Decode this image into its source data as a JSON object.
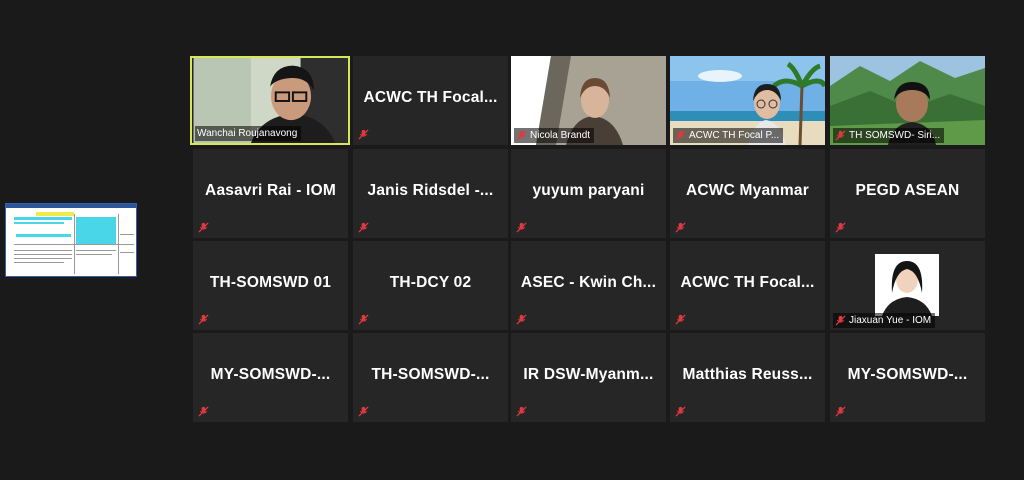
{
  "participants": [
    {
      "name": "Wanchai Roujanavong",
      "video": true,
      "active": true
    },
    {
      "name": "ACWC TH Focal...",
      "video": false
    },
    {
      "name": "Nicola Brandt",
      "video": true
    },
    {
      "name": "ACWC TH Focal P...",
      "video": true
    },
    {
      "name": "TH SOMSWD- Siri...",
      "video": true
    },
    {
      "name": "Aasavri Rai - IOM",
      "video": false
    },
    {
      "name": "Janis Ridsdel -...",
      "video": false
    },
    {
      "name": "yuyum paryani",
      "video": false
    },
    {
      "name": "ACWC Myanmar",
      "video": false
    },
    {
      "name": "PEGD ASEAN",
      "video": false
    },
    {
      "name": "TH-SOMSWD 01",
      "video": false
    },
    {
      "name": "TH-DCY 02",
      "video": false
    },
    {
      "name": "ASEC - Kwin Ch...",
      "video": false
    },
    {
      "name": "ACWC TH Focal...",
      "video": false
    },
    {
      "name": "Jiaxuan Yue - IOM",
      "video": true
    },
    {
      "name": "MY-SOMSWD-...",
      "video": false
    },
    {
      "name": "TH-SOMSWD-...",
      "video": false
    },
    {
      "name": "IR DSW-Myanm...",
      "video": false
    },
    {
      "name": "Matthias Reuss...",
      "video": false
    },
    {
      "name": "MY-SOMSWD-...",
      "video": false
    }
  ],
  "icons": {
    "mic": "mic-muted-icon"
  },
  "colors": {
    "active_border": "#d8e65a",
    "mute": "#e0393e",
    "tile_bg": "#262626",
    "background": "#1a1a1a"
  }
}
